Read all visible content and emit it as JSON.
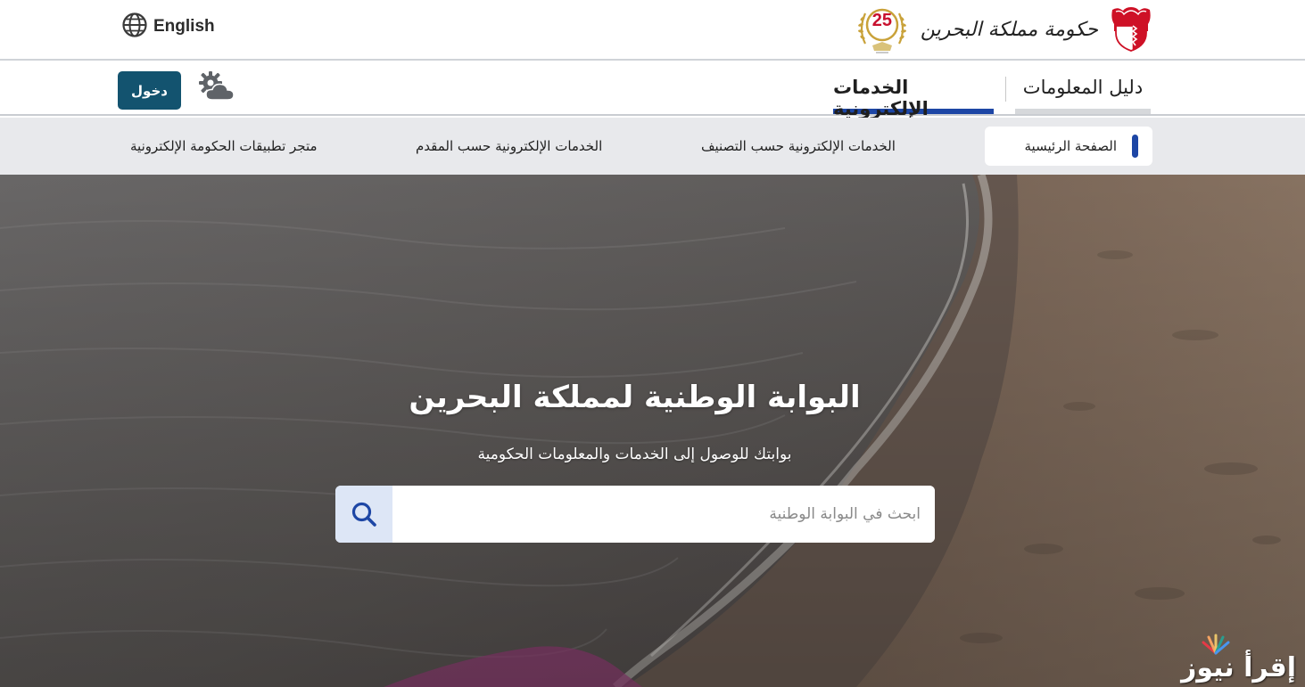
{
  "topbar": {
    "language_label": "English",
    "language_icon": "globe-icon",
    "emblem_number": "25",
    "wordmark": "حكومة مملكة البحرين"
  },
  "mainnav": {
    "login_label": "دخول",
    "settings_icon": "gear-cloud-icon",
    "tabs": [
      {
        "label": "دليل المعلومات",
        "active": false
      },
      {
        "label": "الخدمات الإلكترونية",
        "active": true
      }
    ]
  },
  "subnav": {
    "items": [
      {
        "label": "الصفحة الرئيسية",
        "active": true
      },
      {
        "label": "الخدمات الإلكترونية حسب التصنيف",
        "active": false
      },
      {
        "label": "الخدمات الإلكترونية حسب المقدم",
        "active": false
      },
      {
        "label": "متجر تطبيقات الحكومة الإلكترونية",
        "active": false
      }
    ]
  },
  "hero": {
    "title": "البوابة الوطنية لمملكة البحرين",
    "subtitle": "بوابتك للوصول إلى الخدمات والمعلومات الحكومية",
    "search_placeholder": "ابحث في البوابة الوطنية",
    "search_value": ""
  },
  "watermark": {
    "text": "إقرأ نيوز"
  },
  "colors": {
    "primary_blue": "#1d46a5",
    "login_button": "#13536f",
    "subnav_bg": "#e8e9ec",
    "search_button_bg": "#dde6f6",
    "bahrain_red": "#ce1126"
  }
}
